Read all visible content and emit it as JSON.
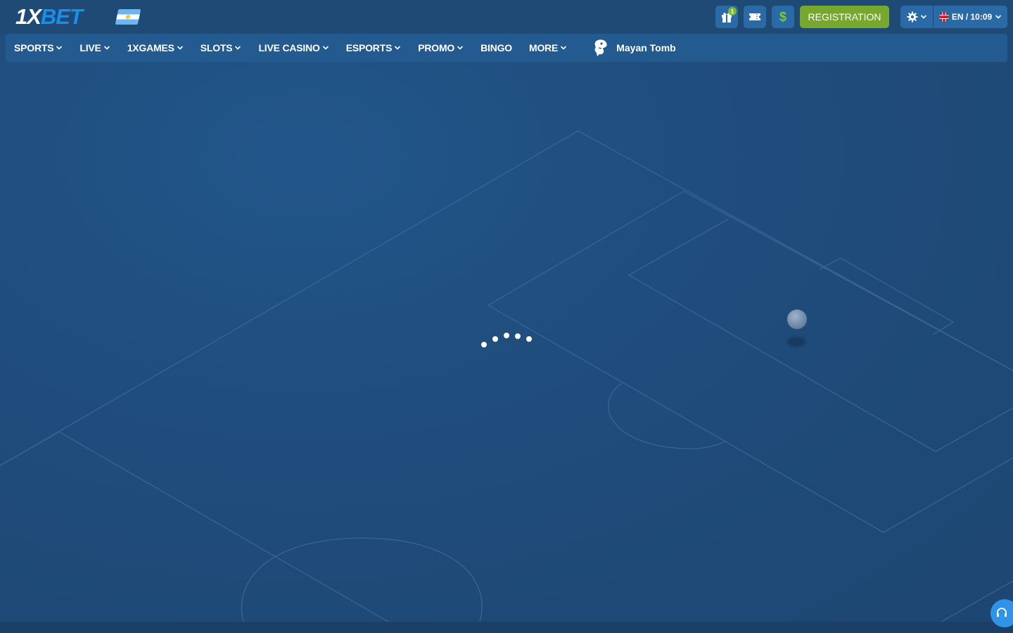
{
  "brand": {
    "logo_prefix": "1X",
    "logo_suffix": "BET",
    "country_flag": "argentina-flag-icon"
  },
  "header": {
    "gift_badge_count": "1",
    "registration_label": "REGISTRATION",
    "language": "EN",
    "time": "10:09",
    "lang_time": "EN / 10:09"
  },
  "nav": {
    "items": [
      {
        "label": "SPORTS",
        "dropdown": true
      },
      {
        "label": "LIVE",
        "dropdown": true
      },
      {
        "label": "1XGAMES",
        "dropdown": true
      },
      {
        "label": "SLOTS",
        "dropdown": true
      },
      {
        "label": "LIVE CASINO",
        "dropdown": true
      },
      {
        "label": "ESPORTS",
        "dropdown": true
      },
      {
        "label": "PROMO",
        "dropdown": true
      },
      {
        "label": "BINGO",
        "dropdown": false
      },
      {
        "label": "MORE",
        "dropdown": true
      }
    ],
    "featured_game": "Mayan Tomb"
  },
  "colors": {
    "accent_green": "#75a82c",
    "brand_blue": "#1a8fe8",
    "nav_bg": "#235a90",
    "page_bg": "#1f4a76"
  },
  "loading": true
}
